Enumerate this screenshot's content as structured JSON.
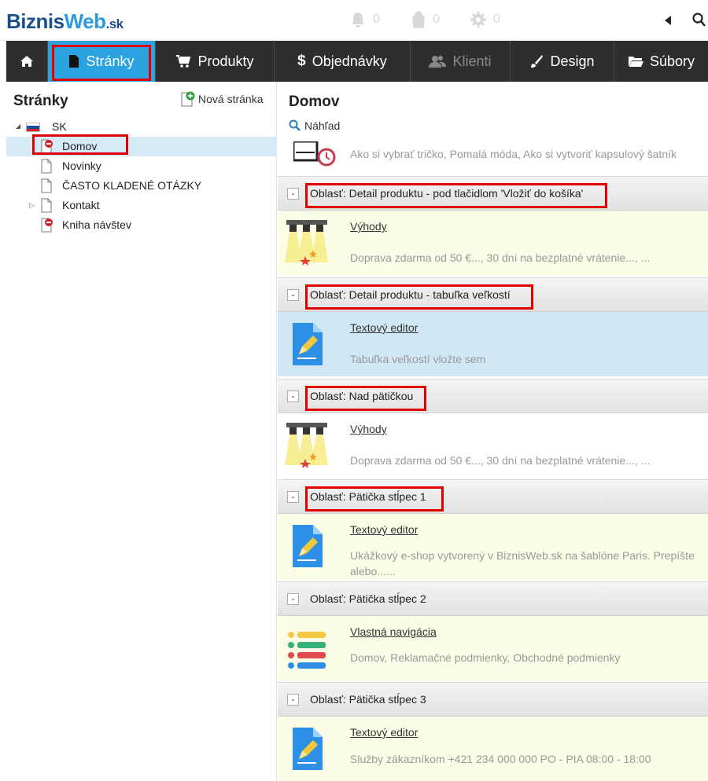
{
  "header": {
    "logo": {
      "part1": "Biznis",
      "part2": "Web",
      "tld": ".sk"
    },
    "indicators": [
      {
        "icon": "bell-icon",
        "count": "0"
      },
      {
        "icon": "shopping-bag-icon",
        "count": "0"
      },
      {
        "icon": "gear-icon",
        "count": "0"
      }
    ]
  },
  "nav": {
    "items": [
      {
        "label": "",
        "icon": "home-icon"
      },
      {
        "label": "Stránky",
        "icon": "page-icon",
        "active": true
      },
      {
        "label": "Produkty",
        "icon": "cart-icon"
      },
      {
        "label": "Objednávky",
        "icon": "dollar-icon"
      },
      {
        "label": "Klienti",
        "icon": "users-icon",
        "disabled": true
      },
      {
        "label": "Design",
        "icon": "brush-icon"
      },
      {
        "label": "Súbory",
        "icon": "folder-icon"
      }
    ],
    "dollar_glyph": "$"
  },
  "left_panel": {
    "title": "Stránky",
    "new_page_label": "Nová stránka",
    "tree": [
      {
        "label": "SK",
        "type": "language"
      },
      {
        "label": "Domov",
        "type": "page-disabled",
        "selected": true
      },
      {
        "label": "Novinky",
        "type": "page"
      },
      {
        "label": "ČASTO KLADENÉ OTÁZKY",
        "type": "page"
      },
      {
        "label": "Kontakt",
        "type": "page",
        "expandable": true
      },
      {
        "label": "Kniha návštev",
        "type": "page-disabled"
      }
    ]
  },
  "right_panel": {
    "title": "Domov",
    "preview_label": "Náhľad",
    "top_partial_desc": "Ako si vybrať tričko, Pomalá móda, Ako si vytvoriť kapsulový šatník",
    "areas": [
      {
        "label": "Oblasť: Detail produktu - pod tlačidlom 'Vložiť do košíka'",
        "widget": {
          "title": "Výhody",
          "desc": "Doprava zdarma od 50 €..., 30 dní na bezplatné vrátenie..., ...",
          "icon": "spotlight-icon"
        }
      },
      {
        "label": "Oblasť: Detail produktu - tabuľka veľkostí",
        "widget": {
          "title": "Textový editor",
          "desc": "Tabuľka veľkostí vložte sem",
          "icon": "text-editor-icon"
        }
      },
      {
        "label": "Oblasť: Nad pätičkou",
        "widget": {
          "title": "Výhody",
          "desc": "Doprava zdarma od 50 €..., 30 dní na bezplatné vrátenie..., ...",
          "icon": "spotlight-icon"
        }
      },
      {
        "label": "Oblasť: Pätička stĺpec 1",
        "widget": {
          "title": "Textový editor",
          "desc": "Ukážkový e-shop vytvorený v BiznisWeb.sk na šablóne Paris. Prepíšte alebo......",
          "icon": "text-editor-icon"
        }
      },
      {
        "label": "Oblasť: Pätička stĺpec 2",
        "widget": {
          "title": "Vlastná navigácia",
          "desc": "Domov, Reklamačné podmienky, Obchodné podmienky",
          "icon": "navigation-list-icon"
        }
      },
      {
        "label": "Oblasť: Pätička stĺpec 3",
        "widget": {
          "title": "Textový editor",
          "desc": "Služby zákazníkom +421 234 000 000 PO - PIA 08:00 - 18:00",
          "icon": "text-editor-icon"
        }
      }
    ],
    "collapse_glyph": "-"
  },
  "colors": {
    "nav_bg": "#2e2e2e",
    "nav_active": "#2aa3e0",
    "highlight": "#e00000",
    "widget_yellow": "#fcfde6",
    "widget_blue": "#d0e7f6"
  }
}
